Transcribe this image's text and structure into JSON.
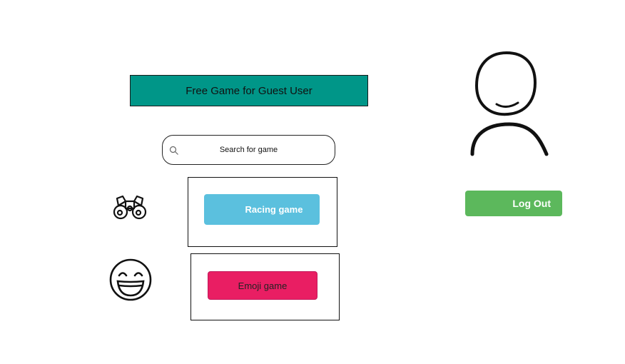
{
  "header": {
    "title": "Free Game for Guest User"
  },
  "search": {
    "placeholder": "Search for game",
    "icon": "search-icon"
  },
  "games": [
    {
      "label": "Racing game",
      "icon": "binoculars-icon",
      "color": "#5bc0de"
    },
    {
      "label": "Emoji game",
      "icon": "smiley-face-icon",
      "color": "#e91e63"
    }
  ],
  "user": {
    "avatar_icon": "user-avatar-icon",
    "logout_label": "Log Out",
    "logout_color": "#5cb85c"
  },
  "colors": {
    "banner": "#009688"
  }
}
